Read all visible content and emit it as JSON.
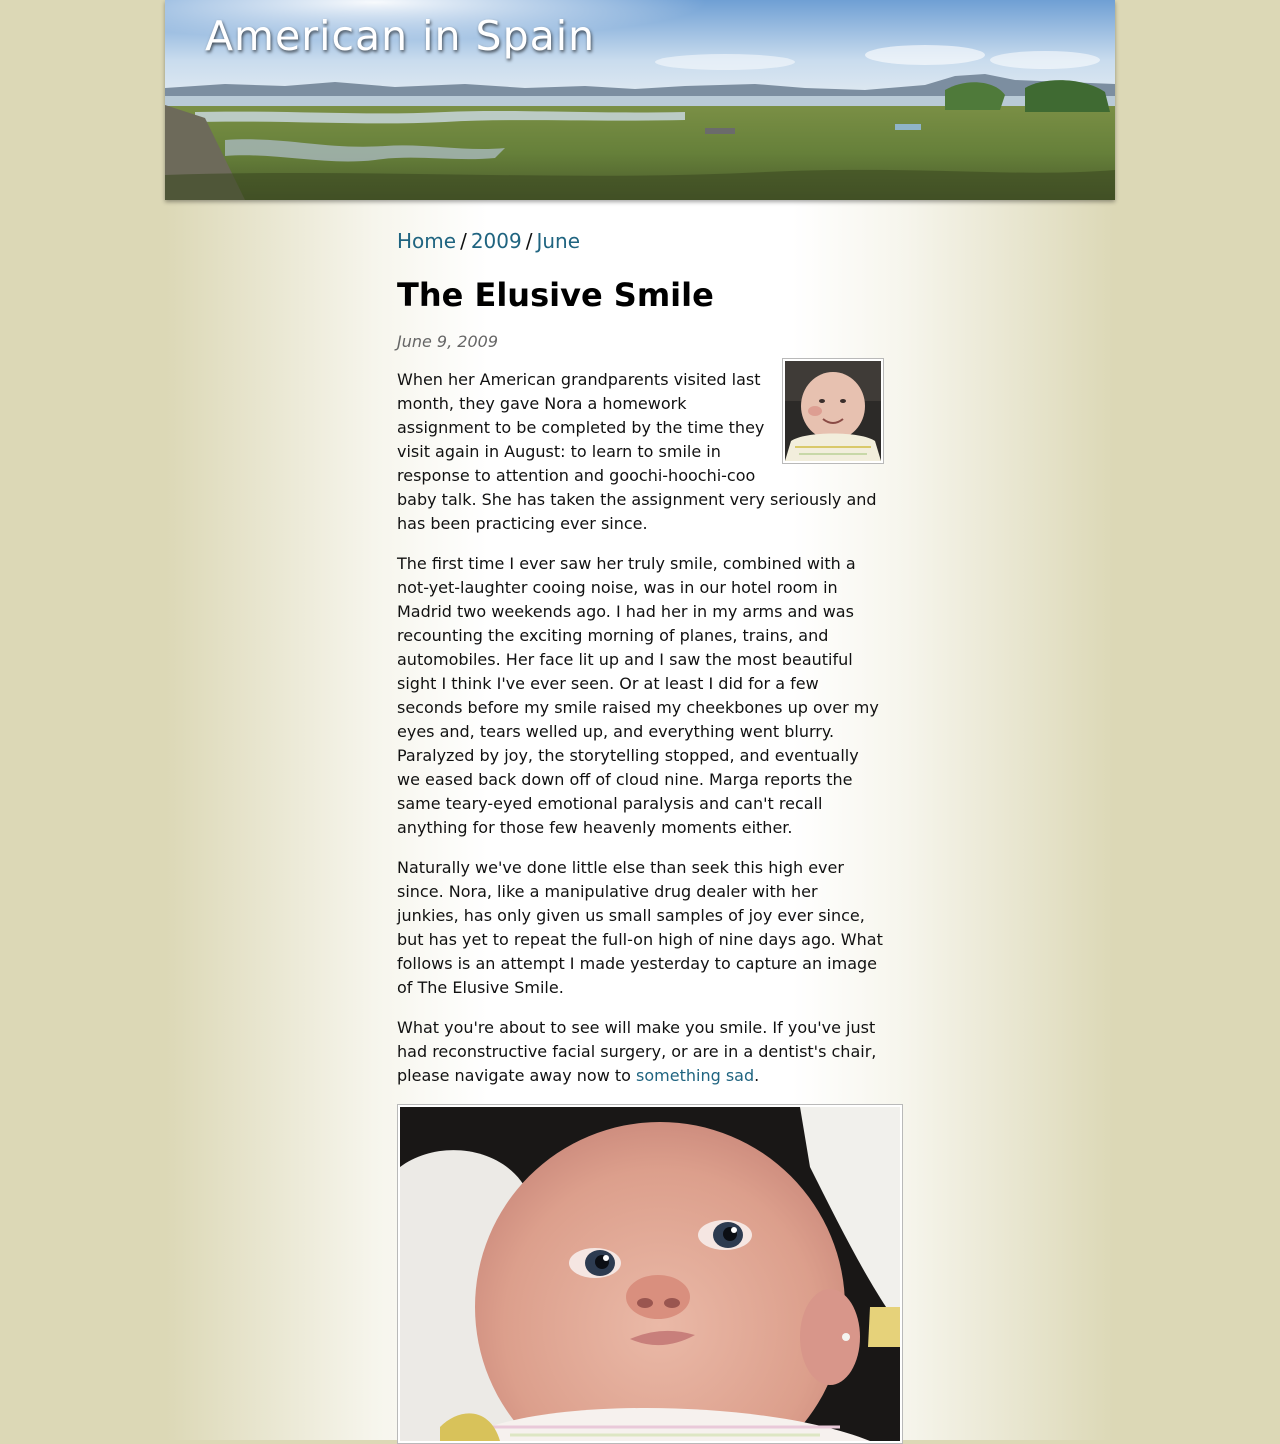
{
  "site": {
    "title": "American in Spain"
  },
  "breadcrumb": {
    "home": "Home",
    "sep1": "/",
    "year": "2009",
    "sep2": "/",
    "month": "June"
  },
  "post": {
    "title": "The Elusive Smile",
    "date": "June 9, 2009",
    "paragraphs": [
      "When her American grandparents visited last month, they gave Nora a homework assignment to be completed by the time they visit again in August: to learn to smile in response to attention and goochi-hoochi-coo baby talk. She has taken the assignment very seriously and has been practicing ever since.",
      "The first time I ever saw her truly smile, combined with a not-yet-laughter cooing noise, was in our hotel room in Madrid two weekends ago. I had her in my arms and was recounting the exciting morning of planes, trains, and automobiles. Her face lit up and I saw the most beautiful sight I think I've ever seen. Or at least I did for a few seconds before my smile raised my cheekbones up over my eyes and, tears welled up, and everything went blurry. Paralyzed by joy, the storytelling stopped, and eventually we eased back down off of cloud nine. Marga reports the same teary-eyed emotional paralysis and can't recall anything for those few heavenly moments either.",
      "Naturally we've done little else than seek this high ever since. Nora, like a manipulative drug dealer with her junkies, has only given us small samples of joy ever since, but has yet to repeat the full-on high of nine days ago. What follows is an attempt I made yesterday to capture an image of The Elusive Smile."
    ],
    "last_paragraph_before_link": "What you're about to see will make you smile. If you've just had reconstructive facial surgery, or are in a dentist's chair, please navigate away now to ",
    "link_text": "something sad",
    "last_paragraph_after_link": "."
  },
  "colors": {
    "page_background": "#dcd8b6",
    "link": "#1f6480"
  }
}
